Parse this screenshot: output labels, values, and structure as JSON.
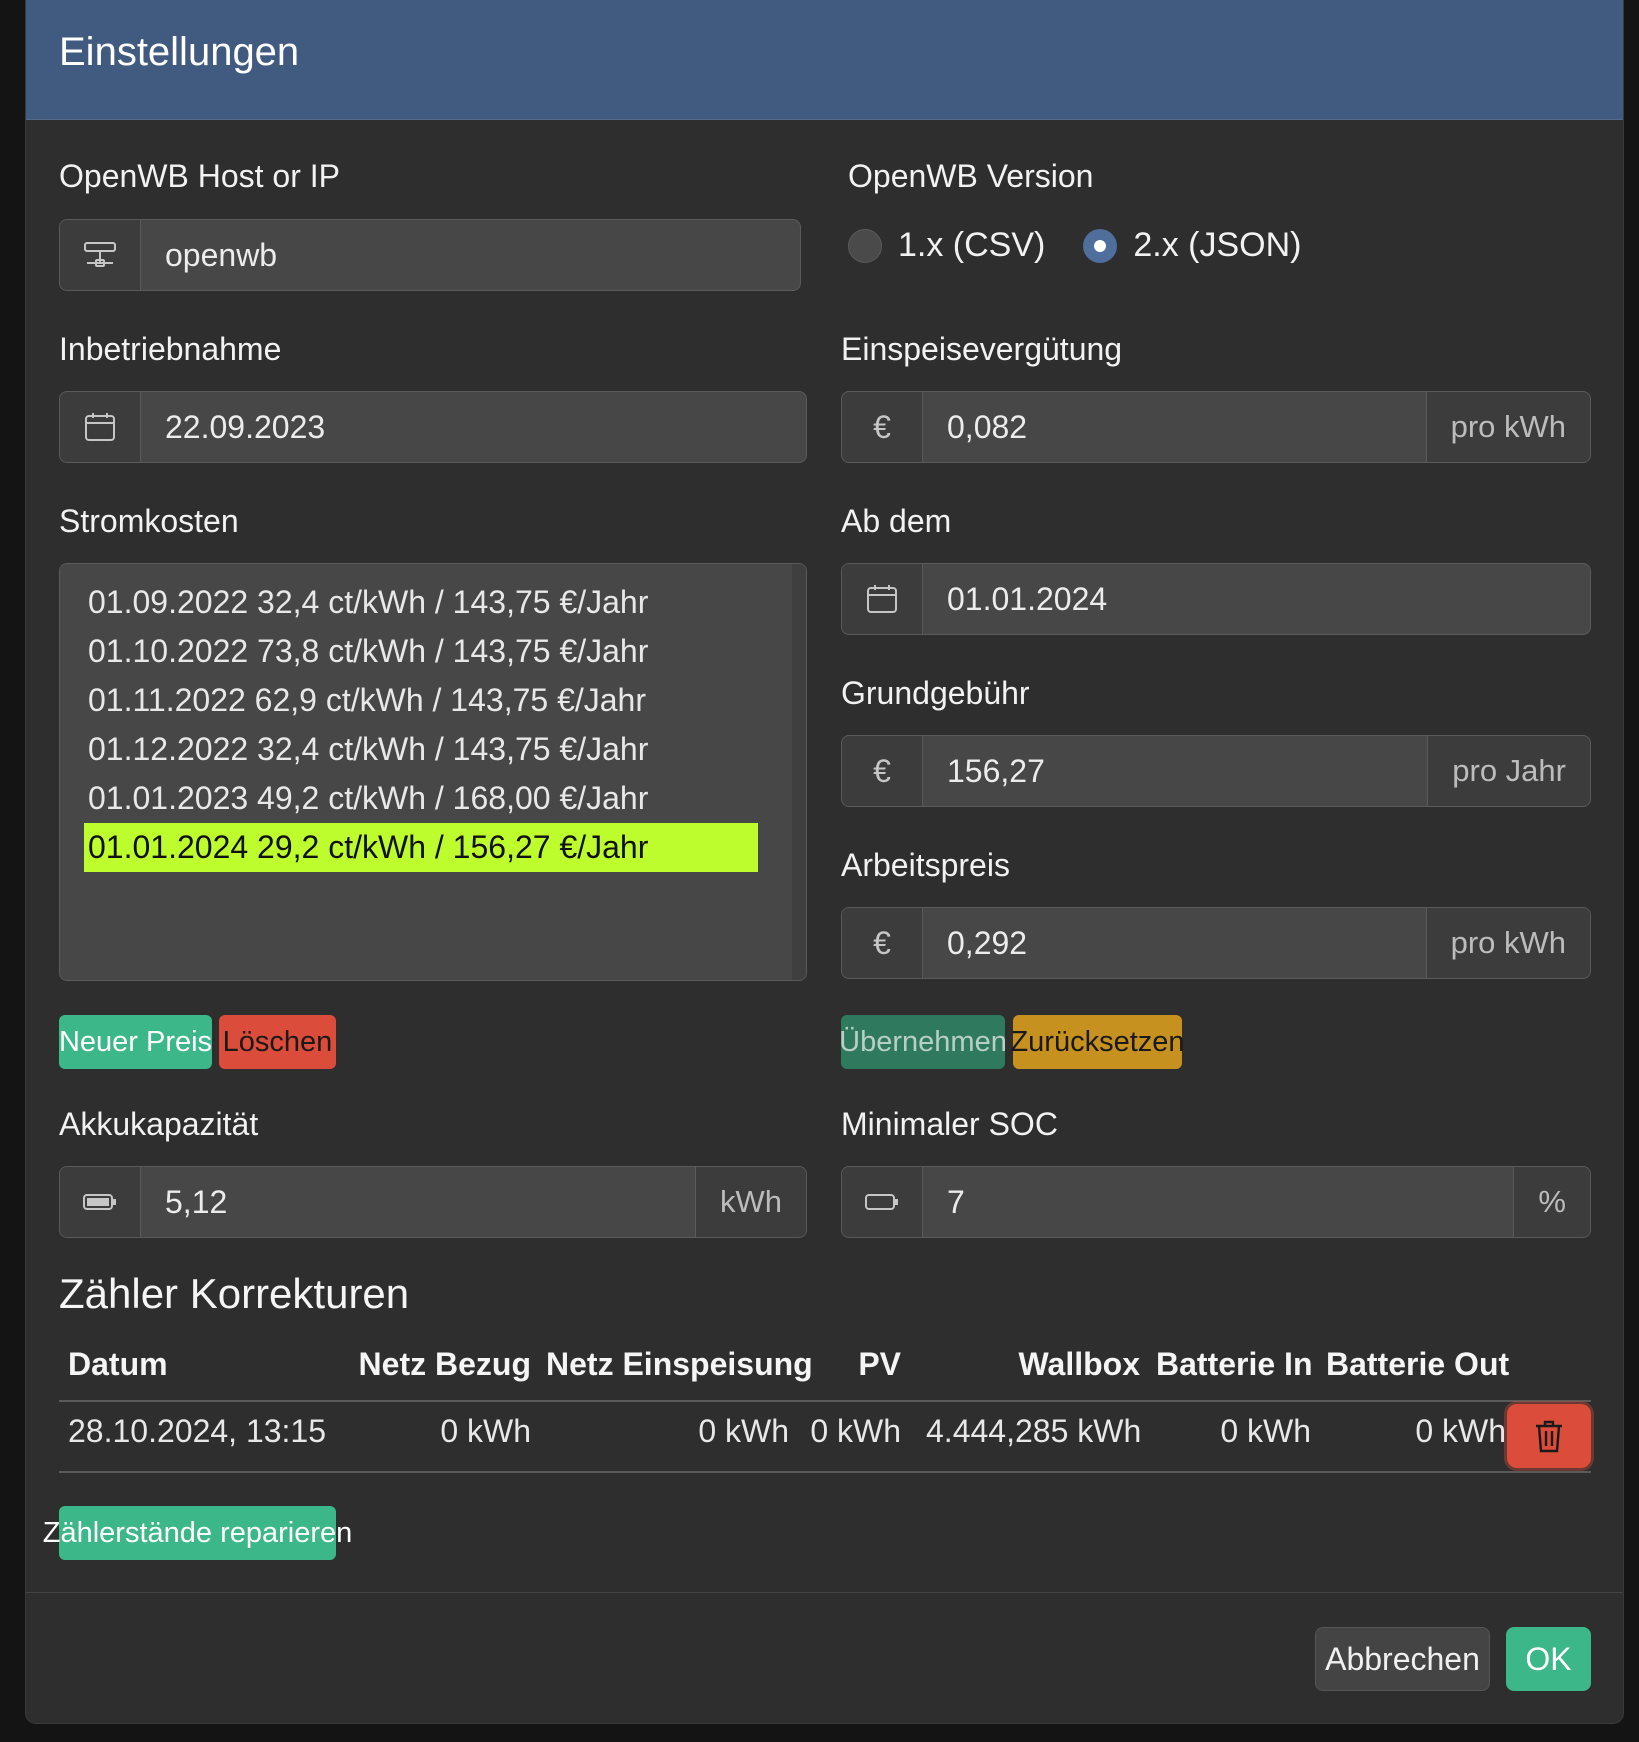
{
  "modal": {
    "title": "Einstellungen"
  },
  "host": {
    "label": "OpenWB Host or IP",
    "value": "openwb",
    "icon": "network-icon"
  },
  "version": {
    "label": "OpenWB Version",
    "options": [
      {
        "label": "1.x (CSV)",
        "checked": false
      },
      {
        "label": "2.x (JSON)",
        "checked": true
      }
    ]
  },
  "inbetriebnahme": {
    "label": "Inbetriebnahme",
    "value": "22.09.2023",
    "icon": "calendar-icon"
  },
  "einspeise": {
    "label": "Einspeisevergütung",
    "currency": "€",
    "value": "0,082",
    "suffix": "pro kWh"
  },
  "stromkosten": {
    "label": "Stromkosten",
    "items": [
      "01.09.2022 32,4 ct/kWh / 143,75 €/Jahr",
      "01.10.2022 73,8 ct/kWh / 143,75 €/Jahr",
      "01.11.2022 62,9 ct/kWh / 143,75 €/Jahr",
      "01.12.2022 32,4 ct/kWh / 143,75 €/Jahr",
      "01.01.2023 49,2 ct/kWh / 168,00 €/Jahr",
      "01.01.2024 29,2 ct/kWh / 156,27 €/Jahr"
    ],
    "selected_index": 5,
    "new_label": "Neuer Preis",
    "delete_label": "Löschen"
  },
  "ab_dem": {
    "label": "Ab dem",
    "value": "01.01.2024",
    "icon": "calendar-icon"
  },
  "grundgebuehr": {
    "label": "Grundgebühr",
    "currency": "€",
    "value": "156,27",
    "suffix": "pro Jahr"
  },
  "arbeitspreis": {
    "label": "Arbeitspreis",
    "currency": "€",
    "value": "0,292",
    "suffix": "pro kWh"
  },
  "price_actions": {
    "apply_label": "Übernehmen",
    "reset_label": "Zurücksetzen"
  },
  "akku": {
    "label": "Akkukapazität",
    "value": "5,12",
    "suffix": "kWh",
    "icon": "battery-full-icon"
  },
  "min_soc": {
    "label": "Minimaler SOC",
    "value": "7",
    "suffix": "%",
    "icon": "battery-empty-icon"
  },
  "korrekturen": {
    "title": "Zähler Korrekturen",
    "headers": [
      "Datum",
      "Netz Bezug",
      "Netz Einspeisung",
      "PV",
      "Wallbox",
      "Batterie In",
      "Batterie Out"
    ],
    "rows": [
      [
        "28.10.2024, 13:15",
        "0 kWh",
        "0 kWh",
        "0 kWh",
        "4.444,285 kWh",
        "0 kWh",
        "0 kWh"
      ]
    ],
    "repair_label": "Zählerstände reparieren"
  },
  "footer": {
    "cancel_label": "Abbrechen",
    "ok_label": "OK"
  },
  "colors": {
    "header": "#405a80",
    "selection": "#bdfc2d",
    "success": "#3cb789",
    "danger": "#dc4c3a",
    "warning": "#c7911f"
  }
}
